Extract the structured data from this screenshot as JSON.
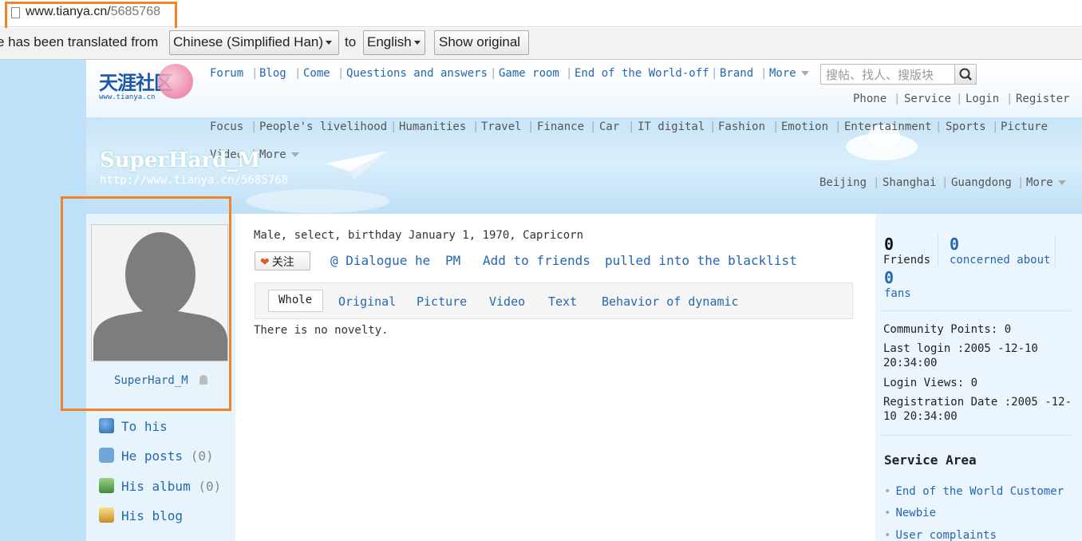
{
  "browser": {
    "url_host": "www.tianya.cn/",
    "url_path": "5685768"
  },
  "translate_bar": {
    "message": "e has been translated from",
    "from_language": "Chinese (Simplified Han)",
    "to_label": "to",
    "to_language": "English",
    "show_original": "Show original"
  },
  "header": {
    "logo_text": "天涯社区",
    "logo_sub": "www.tianya.cn",
    "top_nav": [
      "Forum",
      "Blog",
      "Come",
      "Questions and answers",
      "Game room",
      "End of the World-off",
      "Brand",
      "More"
    ],
    "search_placeholder": "搜帖、找人、搜版块",
    "user_links": [
      "Phone",
      "Service",
      "Login",
      "Register"
    ]
  },
  "channel_nav": [
    "Focus",
    "People's livelihood",
    "Humanities",
    "Travel",
    "Finance",
    "Car",
    "IT digital",
    "Fashion",
    "Emotion",
    "Entertainment",
    "Sports",
    "Picture",
    "Video",
    "More"
  ],
  "region_nav": [
    "Beijing",
    "Shanghai",
    "Guangdong",
    "More"
  ],
  "banner": {
    "username": "SuperHard_M",
    "url": "http://www.tianya.cn/5685768"
  },
  "sidebar": {
    "avatar_name": "SuperHard_M",
    "items": [
      {
        "label": "To his",
        "count": ""
      },
      {
        "label": "He posts",
        "count": "(0)"
      },
      {
        "label": "His album",
        "count": "(0)"
      },
      {
        "label": "His blog",
        "count": ""
      }
    ]
  },
  "profile": {
    "summary": "Male, select, birthday January 1, 1970, Capricorn",
    "follow_button": "关注",
    "actions": [
      "@ Dialogue he",
      "PM",
      "Add to friends",
      "pulled into the blacklist"
    ],
    "tabs": [
      "Whole",
      "Original",
      "Picture",
      "Video",
      "Text",
      "Behavior of dynamic"
    ],
    "empty_message": "There is no novelty."
  },
  "stats": {
    "friends": {
      "value": "0",
      "label": "Friends"
    },
    "concerned": {
      "value": "0",
      "label": "concerned about"
    },
    "fans": {
      "value": "0",
      "label": "fans"
    }
  },
  "info": {
    "points": "Community Points: 0",
    "last_login_1": "Last login :2005 -12-10",
    "last_login_2": "20:34:00",
    "login_views": "Login Views: 0",
    "reg_1": "Registration Date :2005 -12-",
    "reg_2": "10 20:34:00"
  },
  "service_area": {
    "title": "Service Area",
    "items": [
      "End of the World Customer",
      "Newbie",
      "User complaints"
    ]
  },
  "colors": {
    "link": "#2567b0",
    "highlight": "#f0842c",
    "banner": "#c7e4f7"
  }
}
